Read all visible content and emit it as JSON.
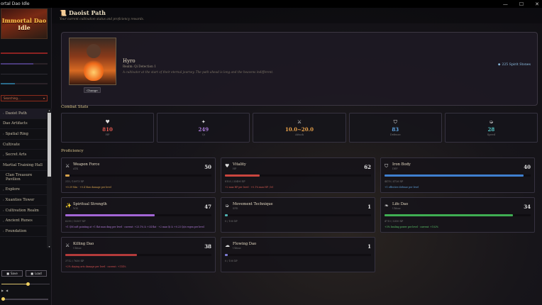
{
  "window": {
    "title": "ortal Dao Idle",
    "minimize": "—",
    "maximize": "☐",
    "close": "✕"
  },
  "sidebar": {
    "logo_line1": "Immortal Dao",
    "logo_line2": "Idle",
    "nav": [
      {
        "label": "Daoist Path",
        "active": true
      },
      {
        "label": "Dao Artifacts"
      },
      {
        "label": "Spatial Ring"
      },
      {
        "label": "Cultivate"
      },
      {
        "label": "Secret Arts"
      },
      {
        "label": "Martial Training Hall"
      },
      {
        "label": "Clan Treasure Pavilion"
      },
      {
        "label": "Explore"
      },
      {
        "label": "Xuanties Tower"
      },
      {
        "label": "Cultivation Realm"
      },
      {
        "label": "Ancient Runes"
      },
      {
        "label": "Foundation"
      }
    ],
    "save_label": "Save",
    "load_label": "Load"
  },
  "header": {
    "title": "Daoist Path",
    "subtitle": "Your current cultivation status and proficiency rewards."
  },
  "profile": {
    "name": "Hyro",
    "realm": "Realm: Qi Detection 1",
    "description": "A cultivator at the start of their eternal journey. The path ahead is long and the heavens indifferent.",
    "change_label": "Change",
    "spirit_stones": "225 Spirit Stones"
  },
  "combat": {
    "heading": "Combat Stats",
    "stats": [
      {
        "icon": "heart-icon",
        "glyph": "♥",
        "value": "810",
        "label": "HP",
        "color": "#e2584f"
      },
      {
        "icon": "sparkle-icon",
        "glyph": "✦",
        "value": "249",
        "label": "Qi",
        "color": "#a97ad8"
      },
      {
        "icon": "swords-icon",
        "glyph": "⚔",
        "value": "10.0~20.0",
        "label": "Attack",
        "color": "#e8a14a"
      },
      {
        "icon": "shield-icon",
        "glyph": "⛉",
        "value": "83",
        "label": "Defense",
        "color": "#5ea3e0"
      },
      {
        "icon": "wind-icon",
        "glyph": "➭",
        "value": "28",
        "label": "Speed",
        "color": "#54c4c4"
      }
    ]
  },
  "proficiency": {
    "heading": "Proficiency",
    "items": [
      {
        "name": "Weapon Force",
        "rank": "ATK",
        "level": "50",
        "icon": "sword-icon",
        "glyph": "⚔",
        "xp": "315 / 10973 XP",
        "bonus": "+0.39 Min · +0.4 Max damage per level",
        "bonus_color": "#d6a24c",
        "bar_color": "#d6a24c",
        "progress": 0.03
      },
      {
        "name": "Vitality",
        "rank": "HP",
        "level": "62",
        "icon": "heart-icon",
        "glyph": "♥",
        "xp": "8103 / 33490 XP",
        "bonus": "+2 max HP per level · +0.1% max HP / lvl",
        "bonus_color": "#d65a50",
        "bar_color": "#c9453e",
        "progress": 0.24
      },
      {
        "name": "Iron Body",
        "rank": "DEF",
        "level": "40",
        "icon": "shield-icon",
        "glyph": "⛉",
        "xp": "4478 / 4726 XP",
        "bonus": "+1 effective defense per level",
        "bonus_color": "#5e9ed8",
        "bar_color": "#3f7fcf",
        "progress": 0.95
      },
      {
        "name": "Spiritual Strength",
        "rank": "WIS",
        "level": "47",
        "icon": "sparkle-icon",
        "glyph": "✨",
        "xp": "6290 / 10307 XP",
        "bonus": "+1 QM soft pointing at +1 flat max dmg per level · current: +23.1% & +34 flat · +2 max Qi & +0.23 Qi/s regen per level",
        "bonus_color": "#b07ad9",
        "bar_color": "#a366d6",
        "progress": 0.61
      },
      {
        "name": "Movement Technique",
        "rank": "SPD",
        "level": "1",
        "icon": "dash-icon",
        "glyph": "➭",
        "xp": "0 / 100 XP",
        "bonus": "",
        "bonus_color": "#9a9a9a",
        "bar_color": "#4fb0b0",
        "progress": 0
      },
      {
        "name": "Life Dao",
        "rank": "Ulitine",
        "level": "34",
        "icon": "leaf-icon",
        "glyph": "❧",
        "xp": "4710 / 5350 XP",
        "bonus": "+3% healing power per level · current: +102%",
        "bonus_color": "#5cc66a",
        "bar_color": "#3fae53",
        "progress": 0.88
      },
      {
        "name": "Killing Dao",
        "rank": "Ulitine",
        "level": "38",
        "icon": "swords-icon",
        "glyph": "⚔",
        "xp": "3712 / 7630 XP",
        "bonus": "+2% slaying arts damage per level · current: +114%",
        "bonus_color": "#d65050",
        "bar_color": "#b33a3a",
        "progress": 0.49
      },
      {
        "name": "Flowing Dao",
        "rank": "Ulitine",
        "level": "1",
        "icon": "cloud-icon",
        "glyph": "☁",
        "xp": "0 / 100 XP",
        "bonus": "",
        "bonus_color": "#9a9a9a",
        "bar_color": "#7a7ad0",
        "progress": 0
      }
    ]
  }
}
